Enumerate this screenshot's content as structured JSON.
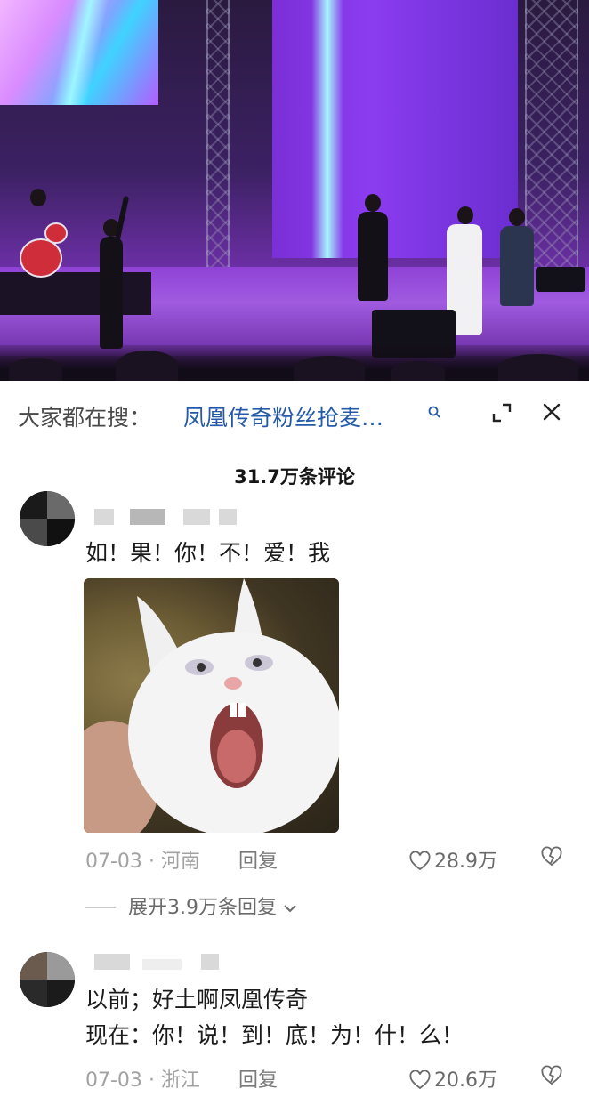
{
  "search": {
    "label": "大家都在搜：",
    "query": "凤凰传奇粉丝抢麦…"
  },
  "comments_count": "31.7万条评论",
  "comments": [
    {
      "text_lines": [
        "如！果！你！不！爱！我"
      ],
      "date": "07-03",
      "location": "· 河南",
      "reply_label": "回复",
      "likes": "28.9万",
      "expand_replies": "展开3.9万条回复"
    },
    {
      "text_lines": [
        "以前；好土啊凤凰传奇",
        "现在：你！说！到！底！为！什！么！"
      ],
      "date": "07-03",
      "location": "· 浙江",
      "reply_label": "回复",
      "likes": "20.6万"
    }
  ],
  "colors": {
    "accent_link": "#245aa8",
    "text_primary": "#1b1b1b",
    "text_secondary": "#a2a2a2",
    "stage_purple": "#7e35b8"
  },
  "icons": [
    "search-icon",
    "expand-icon",
    "close-icon",
    "heart-icon",
    "dislike-icon",
    "chevron-down-icon"
  ]
}
